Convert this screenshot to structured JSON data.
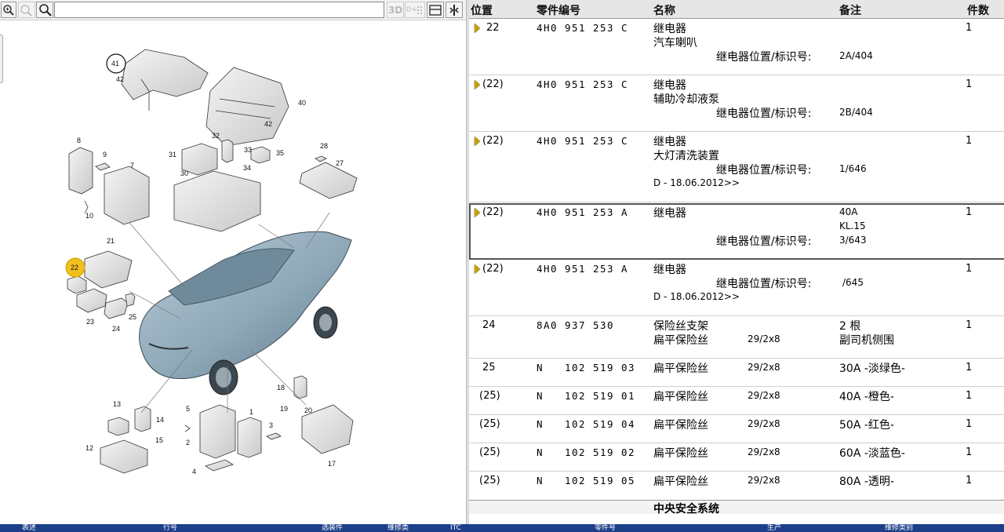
{
  "toolbar": {
    "zoom_in_icon": "magnifier-plus-icon",
    "zoom_100_label": "100%",
    "search_icon": "magnifier-icon",
    "search_value": "",
    "view_3d_label": "3D",
    "hotspot_label": "0+",
    "layout_icon": "split-view-icon",
    "split_icon": "vertical-split-icon"
  },
  "diagram": {
    "callouts": [
      "41",
      "42",
      "40",
      "42",
      "8",
      "9",
      "7",
      "10",
      "32",
      "31",
      "33",
      "35",
      "30",
      "34",
      "28",
      "27",
      "21",
      "22",
      "23",
      "24",
      "25",
      "13",
      "14",
      "12",
      "15",
      "5",
      "2",
      "4",
      "1",
      "3",
      "18",
      "19",
      "17",
      "20"
    ],
    "highlight_callout": "22",
    "accent_color": "#f0c020"
  },
  "table": {
    "headers": {
      "pos": "位置",
      "part": "零件编号",
      "name": "名称",
      "note": "备注",
      "qty": "件数"
    },
    "rows": [
      {
        "pos": "22",
        "part": [
          "4H0",
          "951",
          "253",
          "C"
        ],
        "name": "继电器",
        "name2": "汽车喇叭",
        "sublabel": "继电器位置/标识号:",
        "subval": "2A/404",
        "qty": "1",
        "arrow": true
      },
      {
        "pos": "(22)",
        "part": [
          "4H0",
          "951",
          "253",
          "C"
        ],
        "name": "继电器",
        "name2": "辅助冷却液泵",
        "sublabel": "继电器位置/标识号:",
        "subval": "2B/404",
        "qty": "1",
        "arrow": true
      },
      {
        "pos": "(22)",
        "part": [
          "4H0",
          "951",
          "253",
          "C"
        ],
        "name": "继电器",
        "name2": "大灯清洗装置",
        "sublabel": "继电器位置/标识号:",
        "subval": "1/646",
        "date": "D - 18.06.2012>>",
        "qty": "1",
        "arrow": true
      },
      {
        "pos": "(22)",
        "part": [
          "4H0",
          "951",
          "253",
          "A"
        ],
        "name": "继电器",
        "note1": "40A",
        "note2": "KL.15",
        "sublabel": "继电器位置/标识号:",
        "subval": "3/643",
        "qty": "1",
        "arrow": true,
        "selected": true
      },
      {
        "pos": "(22)",
        "part": [
          "4H0",
          "951",
          "253",
          "A"
        ],
        "name": "继电器",
        "sublabel": "继电器位置/标识号:",
        "subval": "/645",
        "date": "D - 18.06.2012>>",
        "qty": "1",
        "arrow": true
      },
      {
        "pos": "24",
        "part": [
          "8A0",
          "937",
          "530",
          ""
        ],
        "name": "保险丝支架",
        "name2": "扁平保险丝",
        "spec": "29/2x8",
        "note1": "2 根",
        "note2": "副司机侧围",
        "qty": "1"
      },
      {
        "pos": "25",
        "part": [
          "N",
          "102",
          "519",
          "03"
        ],
        "name": "扁平保险丝",
        "spec": "29/2x8",
        "note1": "30A -淡绿色-",
        "qty": "1"
      },
      {
        "pos": "(25)",
        "part": [
          "N",
          "102",
          "519",
          "01"
        ],
        "name": "扁平保险丝",
        "spec": "29/2x8",
        "note1": "40A -橙色-",
        "qty": "1"
      },
      {
        "pos": "(25)",
        "part": [
          "N",
          "102",
          "519",
          "04"
        ],
        "name": "扁平保险丝",
        "spec": "29/2x8",
        "note1": "50A -红色-",
        "qty": "1"
      },
      {
        "pos": "(25)",
        "part": [
          "N",
          "102",
          "519",
          "02"
        ],
        "name": "扁平保险丝",
        "spec": "29/2x8",
        "note1": "60A -淡蓝色-",
        "qty": "1"
      },
      {
        "pos": "(25)",
        "part": [
          "N",
          "102",
          "519",
          "05"
        ],
        "name": "扁平保险丝",
        "spec": "29/2x8",
        "note1": "80A -透明-",
        "qty": "1"
      }
    ],
    "group_title": "中央安全系统"
  },
  "bottombar": {
    "color": "#1c3f8a",
    "labels": [
      "表述",
      "行号",
      "选装件",
      "维修类",
      "ITC",
      "零件号",
      "生产",
      "维修类别"
    ]
  }
}
